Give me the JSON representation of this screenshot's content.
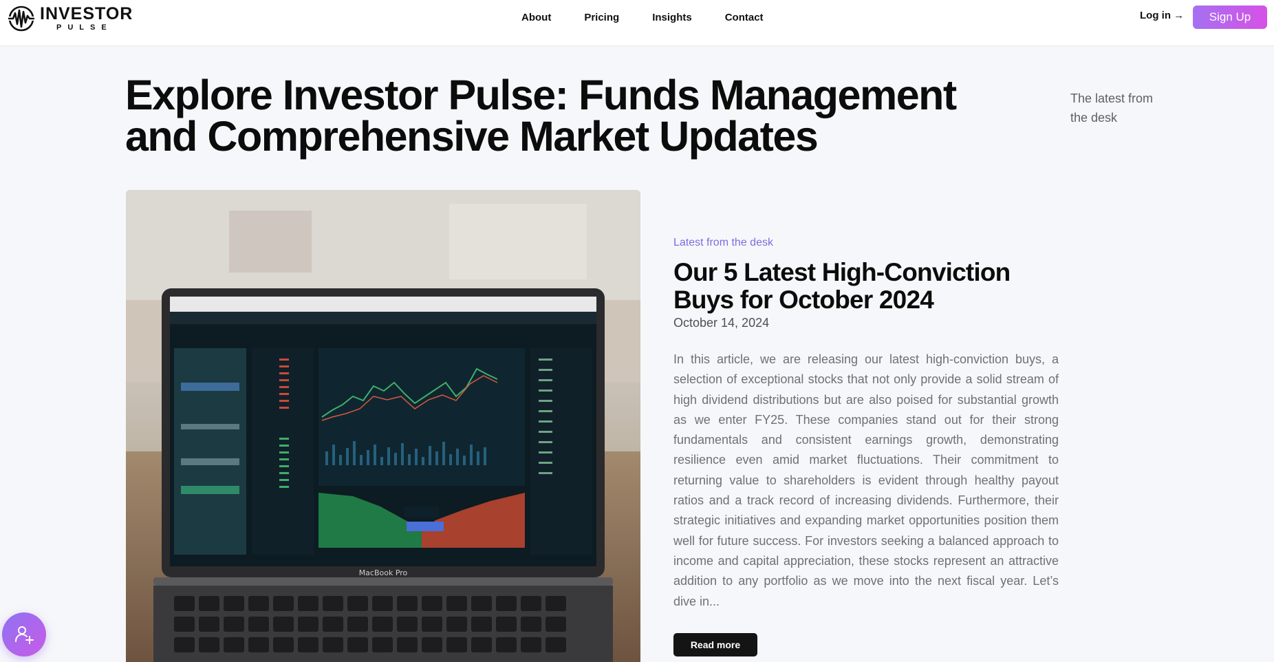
{
  "brand": {
    "name": "INVESTOR",
    "sub": "PULSE"
  },
  "nav": {
    "items": [
      "About",
      "Pricing",
      "Insights",
      "Contact"
    ],
    "login": "Log in →",
    "signup": "Sign Up"
  },
  "hero": {
    "title": "Explore Investor Pulse: Funds Management and Comprehensive Market Updates",
    "side_note": "The latest from the desk"
  },
  "article": {
    "image_caption": "MacBook Pro",
    "eyebrow": "Latest from the desk",
    "title": "Our 5 Latest High-Conviction Buys for October 2024",
    "date": "October 14, 2024",
    "body": "In this article, we are releasing our latest high-conviction buys, a selection of exceptional stocks that not only provide a solid stream of high dividend distributions but are also poised for substantial growth as we enter FY25. These companies stand out for their strong fundamentals and consistent earnings growth, demonstrating resilience even amid market fluctuations. Their commitment to returning value to shareholders is evident through healthy payout ratios and a track record of increasing dividends. Furthermore, their strategic initiatives and expanding market opportunities position them well for future success. For investors seeking a balanced approach to income and capital appreciation, these stocks represent an attractive addition to any portfolio as we move into the next fiscal year. Let’s dive in...",
    "read_more": "Read more"
  },
  "colors": {
    "accent": "#7a6ee0",
    "signup_gradient_start": "#a670f2",
    "signup_gradient_end": "#d651e6",
    "page_bg": "#f6f7fa"
  },
  "icons": {
    "logo": "pulse-wave-logo-icon",
    "fab": "add-user-icon"
  }
}
